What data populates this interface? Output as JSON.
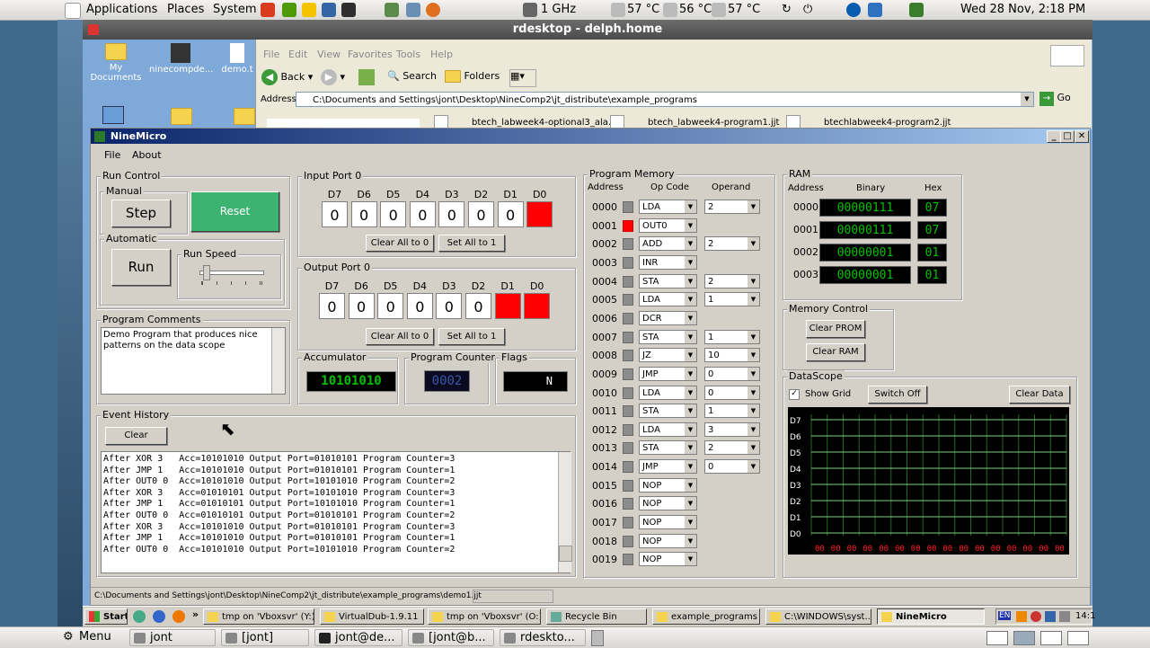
{
  "top_panel": {
    "applications": "Applications",
    "places": "Places",
    "system": "System",
    "cpu_freq": "1 GHz",
    "temp1": "57 °C",
    "temp2": "56 °C",
    "temp3": "57 °C",
    "clock": "Wed 28 Nov, 2:18 PM"
  },
  "rdesktop": {
    "title": "rdesktop - delph.home"
  },
  "desktop_icons": [
    "My Documents",
    "ninecompde...",
    "demo.t"
  ],
  "explorer": {
    "menu": [
      "File",
      "Edit",
      "View",
      "Favorites",
      "Tools",
      "Help"
    ],
    "back": "Back",
    "search": "Search",
    "folders": "Folders",
    "address_label": "Address",
    "address": "C:\\Documents and Settings\\jont\\Desktop\\NineComp2\\jt_distribute\\example_programs",
    "go": "Go",
    "files": [
      "btech_labweek4-optional3_ala...",
      "btech_labweek4-program1.jjt",
      "btechlabweek4-program2.jjt"
    ]
  },
  "app": {
    "title": "NineMicro",
    "menu": [
      "File",
      "About"
    ],
    "run_control": {
      "label": "Run Control",
      "manual": "Manual",
      "step": "Step",
      "reset": "Reset",
      "automatic": "Automatic",
      "run": "Run",
      "run_speed": "Run Speed",
      "run_speed_value": 0.05
    },
    "input_port": {
      "label": "Input Port 0",
      "bits": [
        "D7",
        "D6",
        "D5",
        "D4",
        "D3",
        "D2",
        "D1",
        "D0"
      ],
      "values": [
        "0",
        "0",
        "0",
        "0",
        "0",
        "0",
        "0",
        "1"
      ],
      "clear_all": "Clear All to 0",
      "set_all": "Set All to 1"
    },
    "output_port": {
      "label": "Output Port 0",
      "bits": [
        "D7",
        "D6",
        "D5",
        "D4",
        "D3",
        "D2",
        "D1",
        "D0"
      ],
      "values": [
        "0",
        "0",
        "0",
        "0",
        "0",
        "0",
        "1",
        "1"
      ],
      "clear_all": "Clear All to 0",
      "set_all": "Set All to 1"
    },
    "comments": {
      "label": "Program Comments",
      "text": "Demo Program that produces nice patterns on the data scope"
    },
    "accumulator": {
      "label": "Accumulator",
      "value": "10101010"
    },
    "program_counter": {
      "label": "Program Counter",
      "value": "0002"
    },
    "flags": {
      "label": "Flags",
      "value": "N"
    },
    "event_history": {
      "label": "Event History",
      "clear": "Clear",
      "lines": [
        "After XOR 3   Acc=10101010 Output Port=01010101 Program Counter=3",
        "After JMP 1   Acc=10101010 Output Port=01010101 Program Counter=1",
        "After OUT0 0  Acc=10101010 Output Port=10101010 Program Counter=2",
        "After XOR 3   Acc=01010101 Output Port=10101010 Program Counter=3",
        "After JMP 1   Acc=01010101 Output Port=10101010 Program Counter=1",
        "After OUT0 0  Acc=01010101 Output Port=01010101 Program Counter=2",
        "After XOR 3   Acc=10101010 Output Port=01010101 Program Counter=3",
        "After JMP 1   Acc=10101010 Output Port=01010101 Program Counter=1",
        "After OUT0 0  Acc=10101010 Output Port=10101010 Program Counter=2"
      ]
    },
    "program_memory": {
      "label": "Program Memory",
      "col_address": "Address",
      "col_opcode": "Op Code",
      "col_operand": "Operand",
      "rows": [
        {
          "addr": "0000",
          "op": "LDA",
          "operand": "2",
          "active": false
        },
        {
          "addr": "0001",
          "op": "OUT0",
          "operand": "",
          "active": true
        },
        {
          "addr": "0002",
          "op": "ADD",
          "operand": "2",
          "active": false
        },
        {
          "addr": "0003",
          "op": "INR",
          "operand": "",
          "active": false
        },
        {
          "addr": "0004",
          "op": "STA",
          "operand": "2",
          "active": false
        },
        {
          "addr": "0005",
          "op": "LDA",
          "operand": "1",
          "active": false
        },
        {
          "addr": "0006",
          "op": "DCR",
          "operand": "",
          "active": false
        },
        {
          "addr": "0007",
          "op": "STA",
          "operand": "1",
          "active": false
        },
        {
          "addr": "0008",
          "op": "JZ",
          "operand": "10",
          "active": false
        },
        {
          "addr": "0009",
          "op": "JMP",
          "operand": "0",
          "active": false
        },
        {
          "addr": "0010",
          "op": "LDA",
          "operand": "0",
          "active": false
        },
        {
          "addr": "0011",
          "op": "STA",
          "operand": "1",
          "active": false
        },
        {
          "addr": "0012",
          "op": "LDA",
          "operand": "3",
          "active": false
        },
        {
          "addr": "0013",
          "op": "STA",
          "operand": "2",
          "active": false
        },
        {
          "addr": "0014",
          "op": "JMP",
          "operand": "0",
          "active": false
        },
        {
          "addr": "0015",
          "op": "NOP",
          "operand": "",
          "active": false
        },
        {
          "addr": "0016",
          "op": "NOP",
          "operand": "",
          "active": false
        },
        {
          "addr": "0017",
          "op": "NOP",
          "operand": "",
          "active": false
        },
        {
          "addr": "0018",
          "op": "NOP",
          "operand": "",
          "active": false
        },
        {
          "addr": "0019",
          "op": "NOP",
          "operand": "",
          "active": false
        }
      ]
    },
    "ram": {
      "label": "RAM",
      "col_address": "Address",
      "col_binary": "Binary",
      "col_hex": "Hex",
      "rows": [
        {
          "addr": "0000",
          "bin": "00000111",
          "hex": "07"
        },
        {
          "addr": "0001",
          "bin": "00000111",
          "hex": "07"
        },
        {
          "addr": "0002",
          "bin": "00000001",
          "hex": "01"
        },
        {
          "addr": "0003",
          "bin": "00000001",
          "hex": "01"
        }
      ]
    },
    "memory_control": {
      "label": "Memory Control",
      "clear_prom": "Clear PROM",
      "clear_ram": "Clear RAM"
    },
    "datascope": {
      "label": "DataScope",
      "show_grid": "Show Grid",
      "switch_off": "Switch Off",
      "clear_data": "Clear Data",
      "channels": [
        "D7",
        "D6",
        "D5",
        "D4",
        "D3",
        "D2",
        "D1",
        "D0"
      ],
      "readout": "00",
      "readout_count": 16
    },
    "status_path": "C:\\Documents and Settings\\jont\\Desktop\\NineComp2\\jt_distribute\\example_programs\\demo1.jjt"
  },
  "xp_taskbar": {
    "start": "Start",
    "items": [
      "tmp on 'Vboxsvr' (Y:)",
      "VirtualDub-1.9.11",
      "tmp on 'Vboxsvr' (O:)",
      "Recycle Bin",
      "example_programs",
      "C:\\WINDOWS\\syst...",
      "NineMicro"
    ],
    "lang": "EN",
    "clock": "14:1"
  },
  "bottom_panel": {
    "menu": "Menu",
    "items": [
      "jont",
      "[jont]",
      "jont@de...",
      "[jont@b...",
      "rdeskto..."
    ]
  },
  "colors": {
    "reset_green": "#3cb371",
    "bit_on": "#ff0000",
    "lcd_green": "#00c000",
    "title_blue": "#0a246a"
  }
}
